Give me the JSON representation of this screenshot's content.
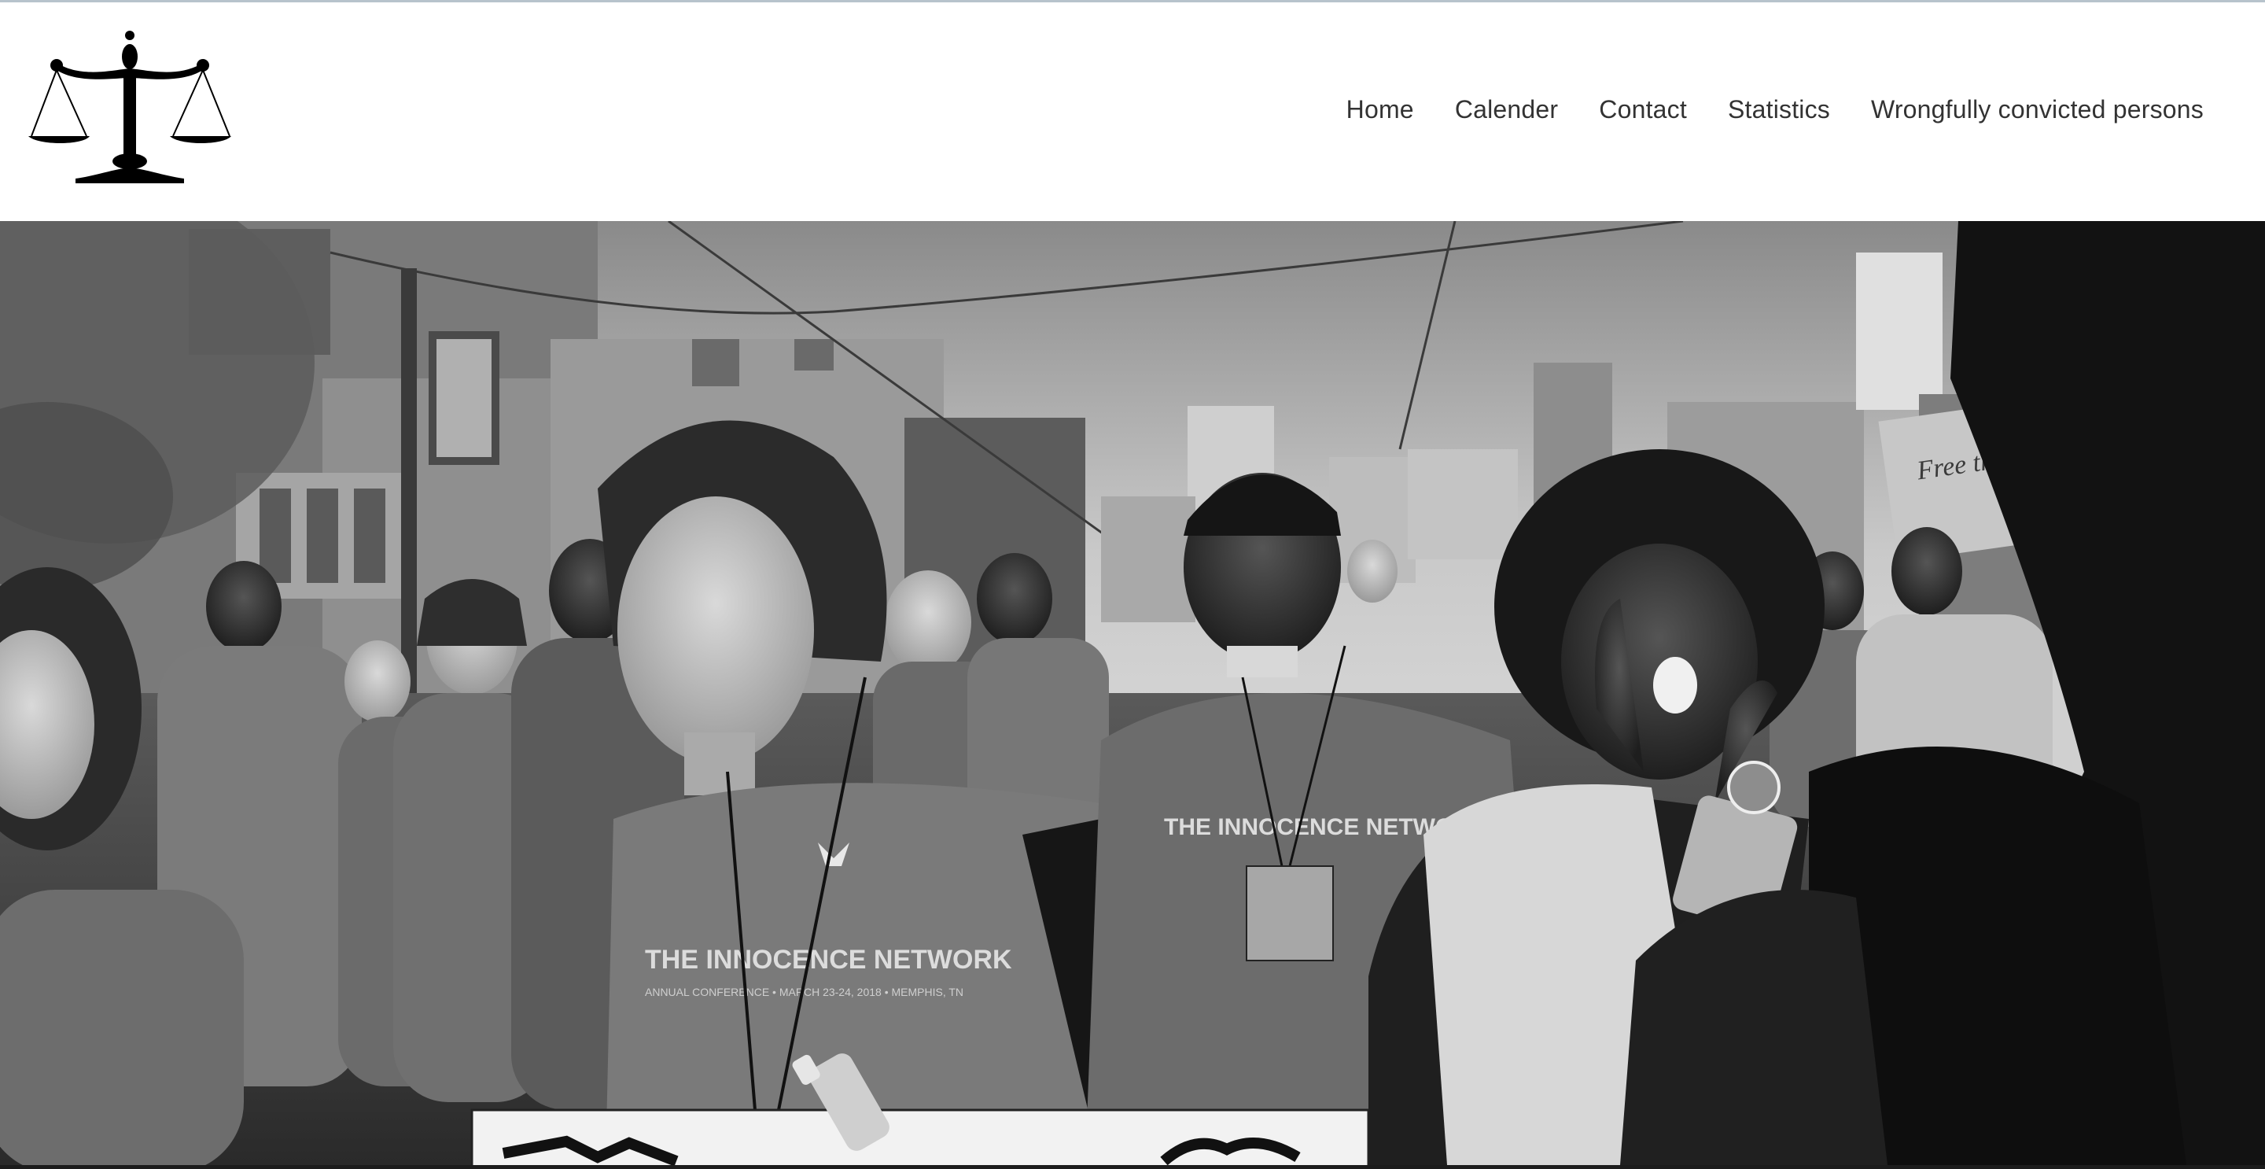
{
  "site": {
    "logo_icon": "scales-of-justice-icon"
  },
  "nav": {
    "items": [
      {
        "label": "Home"
      },
      {
        "label": "Calender"
      },
      {
        "label": "Contact"
      },
      {
        "label": "Statistics"
      },
      {
        "label": "Wrongfully convicted persons"
      }
    ]
  },
  "hero": {
    "image": "black-and-white photo of marchers in THE INNOCENCE NETWORK t-shirts",
    "shirt_text": {
      "line1": "THE INNOCENCE NETWORK",
      "line2": "ANNUAL CONFERENCE • MARCH 23-24, 2018 • MEMPHIS, TN"
    },
    "sign_text": "Free the Innocent"
  }
}
